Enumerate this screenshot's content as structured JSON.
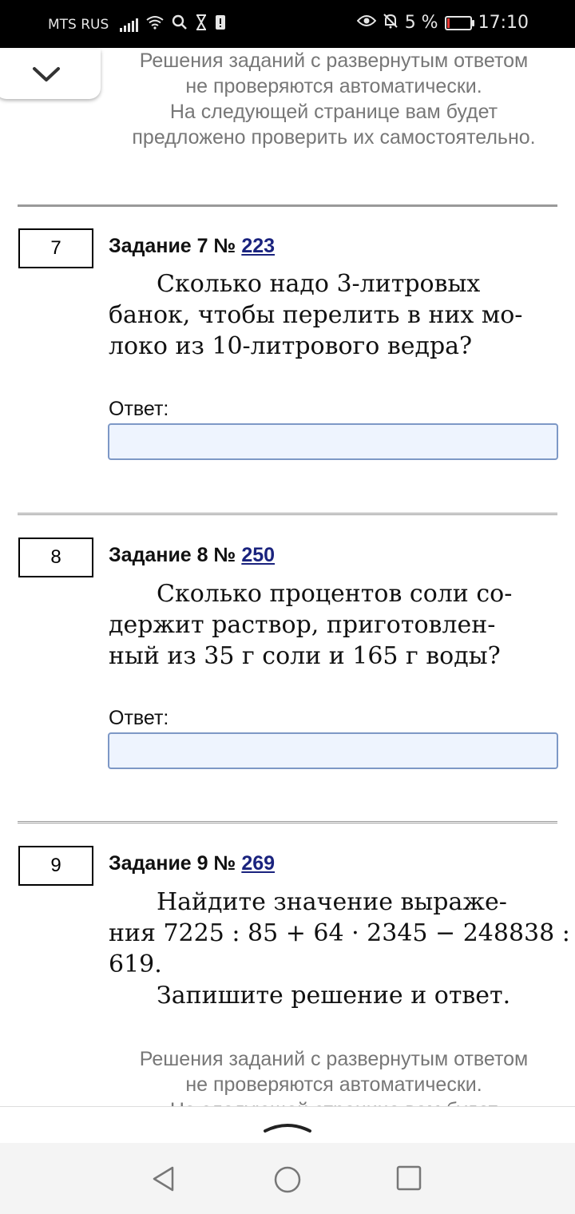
{
  "status_bar": {
    "carrier": "MTS RUS",
    "battery_percent": "5 %",
    "time": "17:10"
  },
  "notes": {
    "top_lines": [
      "Решения заданий с развернутым ответом",
      "не проверяются автоматически.",
      "На следующей странице вам будет",
      "предложено проверить их самостоятельно."
    ],
    "bottom_lines": [
      "Решения заданий с развернутым ответом",
      "не проверяются автоматически.",
      "На следующей странице вам будет"
    ]
  },
  "tasks": [
    {
      "number": "7",
      "title_prefix": "Задание 7 №",
      "id_link": "223",
      "text_lines": [
        "  Сколько надо 3-литровых",
        "банок, чтобы перелить в них мо-",
        "локо из 10-литрового ведра?"
      ],
      "answer_label": "Ответ:",
      "answer_value": ""
    },
    {
      "number": "8",
      "title_prefix": "Задание 8 №",
      "id_link": "250",
      "text_lines": [
        "  Сколько процентов соли со-",
        "держит раствор, приготовлен-",
        "ный из 35 г соли и 165 г воды?"
      ],
      "answer_label": "Ответ:",
      "answer_value": ""
    },
    {
      "number": "9",
      "title_prefix": "Задание 9 №",
      "id_link": "269",
      "text_lines": [
        "  Найдите значение выраже-",
        "ния 7225 : 85 + 64 · 2345 − 248838 :",
        "619.",
        "  Запишите решение и ответ."
      ]
    }
  ],
  "icons": {
    "collapse": "chevron-down-icon",
    "expand_toolbar": "chevron-up-icon",
    "nav_back": "back-triangle-icon",
    "nav_home": "home-circle-icon",
    "nav_recent": "recent-square-icon"
  }
}
